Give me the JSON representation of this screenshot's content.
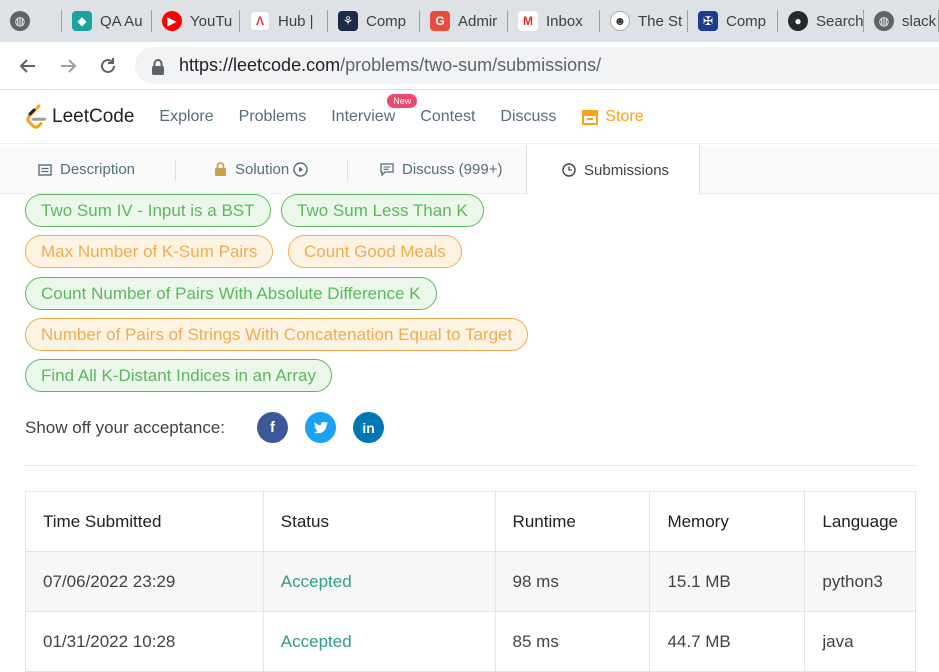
{
  "browser": {
    "tabs": [
      {
        "title": "",
        "icon": "globe-icon",
        "color": "#5f6368"
      },
      {
        "title": "QA Au",
        "icon": "qa-icon",
        "color": "#1aa3a3"
      },
      {
        "title": "YouTu",
        "icon": "youtube-icon",
        "color": "#ff0000"
      },
      {
        "title": "Hub |",
        "icon": "hub-icon",
        "color": "#e53935"
      },
      {
        "title": "Comp",
        "icon": "company-icon",
        "color": "#1a2b4a"
      },
      {
        "title": "Admir",
        "icon": "admin-icon",
        "color": "#e74c3c"
      },
      {
        "title": "Inbox",
        "icon": "gmail-icon",
        "color": "#d93025"
      },
      {
        "title": "The St",
        "icon": "panda-icon",
        "color": "#333333"
      },
      {
        "title": "Comp",
        "icon": "crest-icon",
        "color": "#1d3c8c"
      },
      {
        "title": "Search",
        "icon": "github-icon",
        "color": "#24292e"
      },
      {
        "title": "slack",
        "icon": "globe-icon",
        "color": "#5f6368"
      }
    ],
    "url_host": "https://leetcode.com",
    "url_path": "/problems/two-sum/submissions/"
  },
  "nav": {
    "logo": "LeetCode",
    "links": [
      "Explore",
      "Problems",
      "Interview",
      "Contest",
      "Discuss"
    ],
    "new_badge": "New",
    "store": "Store",
    "accent": "#ffa116"
  },
  "problem_tabs": [
    "Description",
    "Solution",
    "Discuss (999+)",
    "Submissions"
  ],
  "similar": [
    {
      "label": "Two Sum IV - Input is a BST",
      "difficulty": "easy"
    },
    {
      "label": "Two Sum Less Than K",
      "difficulty": "easy"
    },
    {
      "label": "Max Number of K-Sum Pairs",
      "difficulty": "medium"
    },
    {
      "label": "Count Good Meals",
      "difficulty": "medium"
    },
    {
      "label": "Count Number of Pairs With Absolute Difference K",
      "difficulty": "easy"
    },
    {
      "label": "Number of Pairs of Strings With Concatenation Equal to Target",
      "difficulty": "medium"
    },
    {
      "label": "Find All K-Distant Indices in an Array",
      "difficulty": "easy"
    }
  ],
  "share": {
    "label": "Show off your acceptance:",
    "icons": [
      "facebook-icon",
      "twitter-icon",
      "linkedin-icon"
    ]
  },
  "table": {
    "headers": [
      "Time Submitted",
      "Status",
      "Runtime",
      "Memory",
      "Language"
    ],
    "rows": [
      [
        "07/06/2022 23:29",
        "Accepted",
        "98 ms",
        "15.1 MB",
        "python3"
      ],
      [
        "01/31/2022 10:28",
        "Accepted",
        "85 ms",
        "44.7 MB",
        "java"
      ]
    ]
  }
}
